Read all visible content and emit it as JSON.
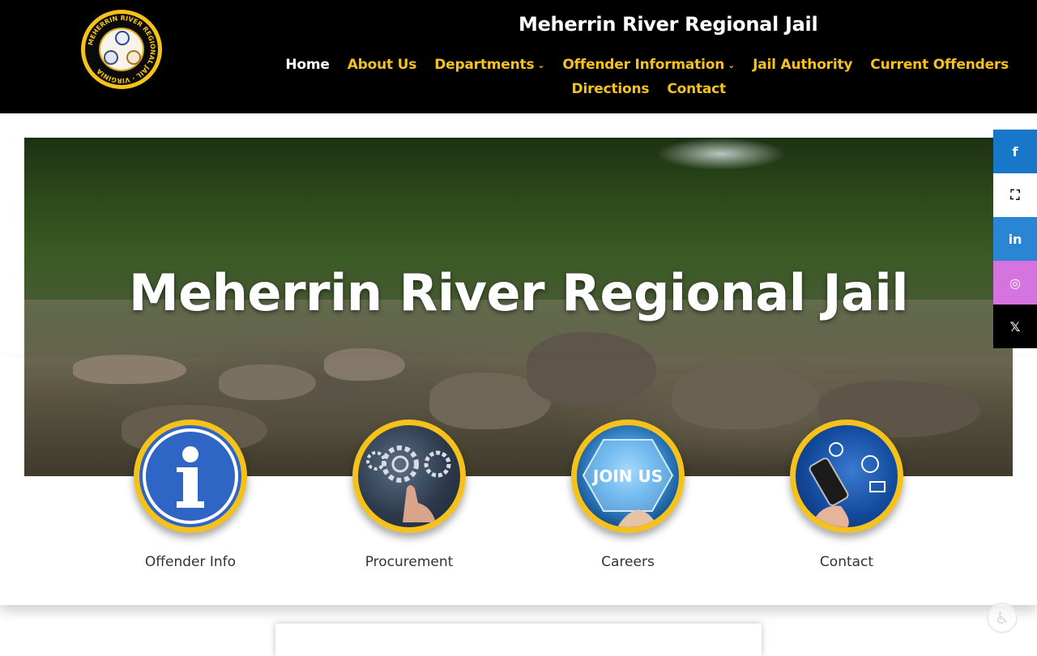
{
  "header": {
    "site_title": "Meherrin River Regional Jail",
    "logo_text": "MEHERRIN RIVER REGIONAL JAIL · VIRGINIA"
  },
  "nav": {
    "row1": [
      {
        "label": "Home",
        "active": true,
        "dropdown": false
      },
      {
        "label": "About Us",
        "active": false,
        "dropdown": false
      },
      {
        "label": "Departments",
        "active": false,
        "dropdown": true
      },
      {
        "label": "Offender Information",
        "active": false,
        "dropdown": true
      },
      {
        "label": "Jail Authority",
        "active": false,
        "dropdown": false
      },
      {
        "label": "Current Offenders",
        "active": false,
        "dropdown": false
      }
    ],
    "row2": [
      {
        "label": "Directions",
        "active": false,
        "dropdown": false
      },
      {
        "label": "Contact",
        "active": false,
        "dropdown": false
      }
    ]
  },
  "hero": {
    "title": "Meherrin River Regional Jail"
  },
  "social": [
    {
      "icon": "facebook-icon",
      "glyph": "f",
      "color": "#1877c9"
    },
    {
      "icon": "map-icon",
      "glyph": "⛶",
      "color": "#ffffff"
    },
    {
      "icon": "linkedin-icon",
      "glyph": "in",
      "color": "#2a86d4"
    },
    {
      "icon": "instagram-icon",
      "glyph": "◎",
      "color": "#d674df"
    },
    {
      "icon": "x-icon",
      "glyph": "𝕏",
      "color": "#000000"
    }
  ],
  "tiles": [
    {
      "label": "Offender Info",
      "icon": "info-icon"
    },
    {
      "label": "Procurement",
      "icon": "gears-icon"
    },
    {
      "label": "Careers",
      "icon": "join-us-icon",
      "badge_text": "JOIN US"
    },
    {
      "label": "Contact",
      "icon": "phone-contact-icon"
    }
  ],
  "colors": {
    "header_bg": "#000000",
    "accent": "#f4c21b",
    "nav_active": "#ffffff"
  }
}
